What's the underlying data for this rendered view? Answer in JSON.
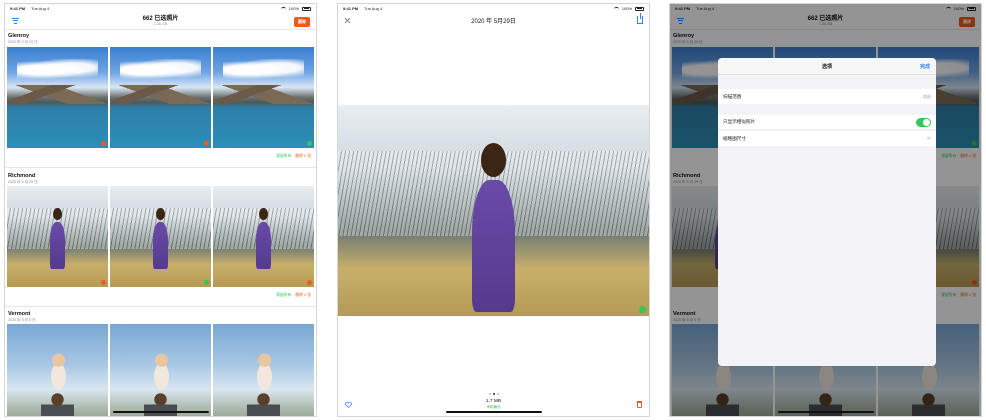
{
  "status": {
    "time": "9:41 PM",
    "date": "Tue Aug 4",
    "battery": "100%"
  },
  "list_screen": {
    "title": "662 已选照片",
    "subtitle": "1.35 GB",
    "delete_label": "删除",
    "groups": [
      {
        "title": "Glenroy",
        "date": "2020 年 5 月 29 日",
        "keep": "保留所有",
        "delete": "删除 2 张",
        "badges": [
          "orange",
          "orange",
          "green"
        ]
      },
      {
        "title": "Richmond",
        "date": "2020 年 5 月 29 日",
        "keep": "保留所有",
        "delete": "删除 2 张",
        "badges": [
          "orange",
          "green",
          "orange"
        ]
      },
      {
        "title": "Vermont",
        "date": "2020 年 5 月 5 日",
        "badges": [
          "",
          "green",
          ""
        ]
      }
    ]
  },
  "detail_screen": {
    "title": "2020 年 5月29日",
    "size": "1.7 MB",
    "status": "本机最佳"
  },
  "options_screen": {
    "sheet_title": "选项",
    "done_label": "完成",
    "rows": [
      {
        "label": "扫描范围",
        "value": "相册"
      },
      {
        "label": "只显示相似照片",
        "toggle": true
      },
      {
        "label": "缩略图尺寸",
        "value": "中"
      }
    ]
  },
  "colors": {
    "accent": "#2f87f5",
    "delete": "#ef5a1e",
    "keep": "#34c759"
  }
}
